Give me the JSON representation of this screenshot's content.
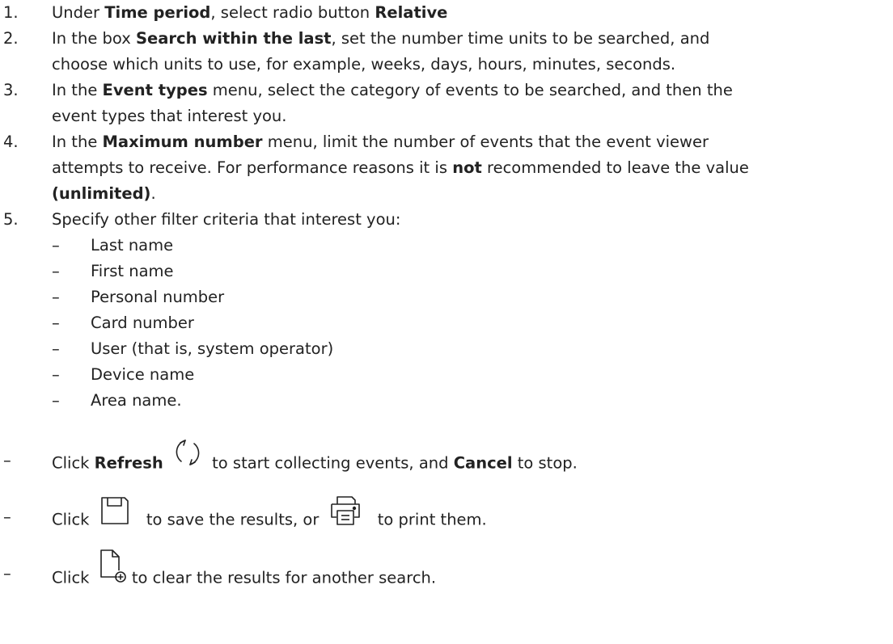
{
  "steps": [
    {
      "num": "1.",
      "parts": [
        "Under ",
        "Time period",
        ", select radio button ",
        "Relative"
      ]
    },
    {
      "num": "2.",
      "line1": [
        "In the box ",
        "Search within the last",
        ", set the number time units to be searched, and"
      ],
      "line2": "choose which units to use, for example, weeks, days, hours, minutes, seconds."
    },
    {
      "num": "3.",
      "line1": [
        "In the ",
        "Event types",
        " menu, select the category of events to be searched, and then the"
      ],
      "line2": "event types that interest you."
    },
    {
      "num": "4.",
      "line1": [
        "In the ",
        "Maximum number",
        " menu, limit the number of events that the event viewer"
      ],
      "line2": [
        "attempts to receive. For performance reasons it is ",
        "not",
        " recommended to leave the value"
      ],
      "line3": [
        "(unlimited)",
        "."
      ]
    },
    {
      "num": "5.",
      "text": "Specify other filter criteria that interest you:"
    }
  ],
  "dash": "–",
  "criteria": [
    "Last name",
    "First name",
    "Personal number",
    "Card number",
    "User (that is, system operator)",
    "Device name",
    "Area name."
  ],
  "actions": {
    "refresh": {
      "pre": "Click ",
      "bold1": "Refresh",
      "mid": " to start collecting events, and ",
      "bold2": "Cancel",
      "post": " to stop."
    },
    "save": {
      "pre": "Click ",
      "mid": " to save the results, or ",
      "post": " to print them."
    },
    "clear": {
      "pre": "Click ",
      "post": " to clear the results for another search."
    }
  },
  "icons": {
    "refresh": "refresh-icon",
    "save": "save-icon",
    "print": "print-icon",
    "new": "new-document-icon"
  }
}
